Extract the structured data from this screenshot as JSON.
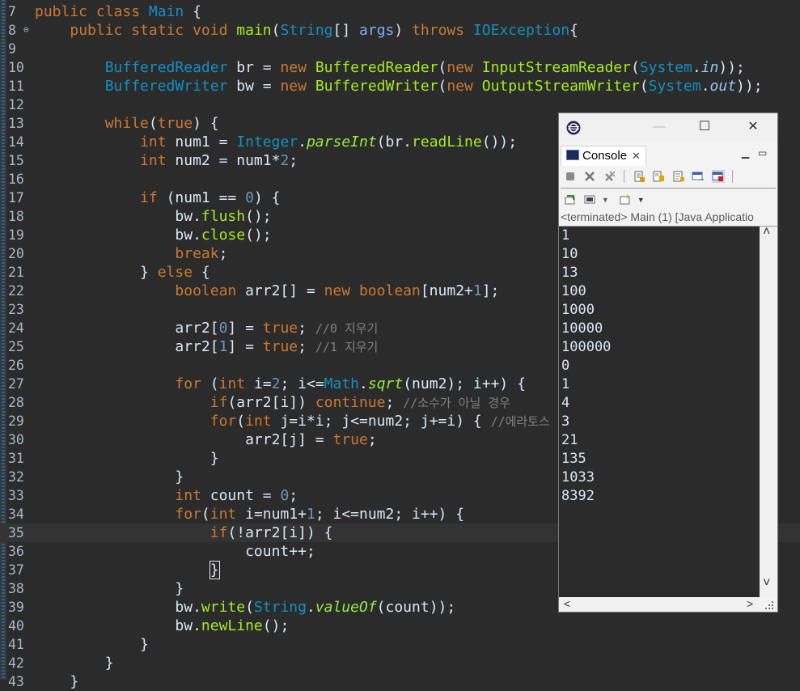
{
  "editor": {
    "lines": [
      {
        "n": "7",
        "html": "<span class=\"kw\">public class</span> <span class=\"cls\">Main</span> {"
      },
      {
        "n": "8",
        "fold": true,
        "html": "    <span class=\"kw\">public static void</span> <span class=\"fn\">main</span>(<span class=\"cls\">String</span>[] <span class=\"stat\" style=\"font-style:normal;color:#79abff\">args</span>) <span class=\"kw\">throws</span> <span class=\"cls\">IOException</span>{"
      },
      {
        "n": "9",
        "html": ""
      },
      {
        "n": "10",
        "html": "        <span class=\"cls\">BufferedReader</span> br = <span class=\"kw\">new</span> <span class=\"fn\">BufferedReader</span>(<span class=\"kw\">new</span> <span class=\"fn\">InputStreamReader</span>(<span class=\"cls\">System</span>.<span class=\"stat\">in</span>));"
      },
      {
        "n": "11",
        "html": "        <span class=\"cls\">BufferedWriter</span> bw = <span class=\"kw\">new</span> <span class=\"fn\">BufferedWriter</span>(<span class=\"kw\">new</span> <span class=\"fn\">OutputStreamWriter</span>(<span class=\"cls\">System</span>.<span class=\"stat\">out</span>));"
      },
      {
        "n": "12",
        "html": ""
      },
      {
        "n": "13",
        "html": "        <span class=\"kw\">while</span>(<span class=\"kw\">true</span>) {"
      },
      {
        "n": "14",
        "html": "            <span class=\"kw\">int</span> num1 = <span class=\"cls\">Integer</span>.<span class=\"stat\" style=\"color:#96ec3f\">parseInt</span>(br.<span class=\"fn\">readLine</span>());"
      },
      {
        "n": "15",
        "html": "            <span class=\"kw\">int</span> num2 = num1*<span class=\"num\">2</span>;"
      },
      {
        "n": "16",
        "html": ""
      },
      {
        "n": "17",
        "html": "            <span class=\"kw\">if</span> (num1 == <span class=\"num\">0</span>) {"
      },
      {
        "n": "18",
        "html": "                bw.<span class=\"fn\">flush</span>();"
      },
      {
        "n": "19",
        "html": "                bw.<span class=\"fn\">close</span>();"
      },
      {
        "n": "20",
        "html": "                <span class=\"kw\">break</span>;"
      },
      {
        "n": "21",
        "html": "            } <span class=\"kw\">else</span> {"
      },
      {
        "n": "22",
        "html": "                <span class=\"kw\">boolean</span> arr2[] = <span class=\"kw\">new boolean</span>[num2+<span class=\"num\">1</span>];"
      },
      {
        "n": "23",
        "html": ""
      },
      {
        "n": "24",
        "html": "                arr2[<span class=\"num\">0</span>] = <span class=\"kw\">true</span>; <span class=\"cmt\">//0 지우기</span>"
      },
      {
        "n": "25",
        "html": "                arr2[<span class=\"num\">1</span>] = <span class=\"kw\">true</span>; <span class=\"cmt\">//1 지우기</span>"
      },
      {
        "n": "26",
        "html": ""
      },
      {
        "n": "27",
        "html": "                <span class=\"kw\">for</span> (<span class=\"kw\">int</span> i=<span class=\"num\">2</span>; i&lt;=<span class=\"cls\">Math</span>.<span class=\"stat\" style=\"color:#96ec3f\">sqrt</span>(num2); i++) {"
      },
      {
        "n": "28",
        "html": "                    <span class=\"kw\">if</span>(arr2[i]) <span class=\"kw\">continue</span>; <span class=\"cmt\">//소수가 아닐 경우</span>"
      },
      {
        "n": "29",
        "html": "                    <span class=\"kw\">for</span>(<span class=\"kw\">int</span> j=i*i; j&lt;=num2; j+=i) { <span class=\"cmt\">//에라토스</span>"
      },
      {
        "n": "30",
        "html": "                        arr2[j] = <span class=\"kw\">true</span>;"
      },
      {
        "n": "31",
        "html": "                    }"
      },
      {
        "n": "32",
        "html": "                }"
      },
      {
        "n": "33",
        "html": "                <span class=\"kw\">int</span> count = <span class=\"num\">0</span>;"
      },
      {
        "n": "34",
        "html": "                <span class=\"kw\">for</span>(<span class=\"kw\">int</span> i=num1+<span class=\"num\">1</span>; i&lt;=num2; i++) {"
      },
      {
        "n": "35",
        "current": true,
        "html": "                    <span class=\"kw\">if</span>(!arr2[i]) {"
      },
      {
        "n": "36",
        "html": "                        count++;"
      },
      {
        "n": "37",
        "html": "                    <span class=\"caret\">}</span>"
      },
      {
        "n": "38",
        "html": "                }"
      },
      {
        "n": "39",
        "html": "                bw.<span class=\"fn\">write</span>(<span class=\"cls\">String</span>.<span class=\"stat\" style=\"color:#96ec3f\">valueOf</span>(count));"
      },
      {
        "n": "40",
        "html": "                bw.<span class=\"fn\">newLine</span>();"
      },
      {
        "n": "41",
        "html": "            }"
      },
      {
        "n": "42",
        "html": "        }"
      },
      {
        "n": "43",
        "html": "    }"
      }
    ]
  },
  "console": {
    "window_controls": {
      "minimize": "—",
      "maximize": "☐",
      "close": "✕"
    },
    "tab_label": "Console",
    "tab_close": "✕",
    "view_minimize": "▁",
    "view_maximize": "▭",
    "status": "<terminated> Main (1) [Java Applicatio",
    "output": [
      "1",
      "10",
      "13",
      "100",
      "1000",
      "10000",
      "100000",
      "0",
      "1",
      "4",
      "3",
      "21",
      "135",
      "1033",
      "8392"
    ],
    "scroll_up": "˄",
    "scroll_down": "˅",
    "scroll_left": "<",
    "scroll_right": ">"
  }
}
